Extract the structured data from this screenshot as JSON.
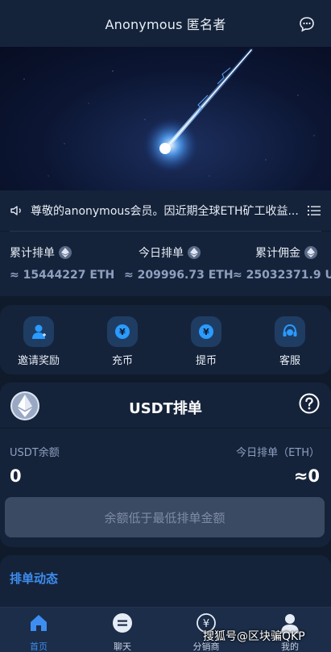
{
  "header": {
    "title": "Anonymous 匿名者",
    "chat_icon": "chat-bubble-icon"
  },
  "banner": {
    "image": "meteor-streak"
  },
  "notice": {
    "text": "尊敬的anonymous会员。因近期全球ETH矿工收益...",
    "speaker_icon": "speaker-icon",
    "list_icon": "list-icon"
  },
  "stats": [
    {
      "label": "累计排单",
      "value": "≈ 15444227 ETH"
    },
    {
      "label": "今日排单",
      "value": "≈ 209996.73 ETH"
    },
    {
      "label": "累计佣金",
      "value": "≈ 25032371.9 U"
    }
  ],
  "quick_actions": [
    {
      "label": "邀请奖励",
      "icon": "user-add-icon"
    },
    {
      "label": "充币",
      "icon": "deposit-icon"
    },
    {
      "label": "提币",
      "icon": "withdraw-icon"
    },
    {
      "label": "客服",
      "icon": "headset-icon"
    }
  ],
  "order_card": {
    "title": "USDT排单",
    "balance_label": "USDT余额",
    "balance_value": "0",
    "today_label": "今日排单（ETH）",
    "today_value": "≈0",
    "action_label": "余额低于最低排单金额"
  },
  "dynamic": {
    "title": "排单动态"
  },
  "tabbar": [
    {
      "label": "首页",
      "icon": "home-icon",
      "active": true
    },
    {
      "label": "聊天",
      "icon": "chat-icon",
      "active": false
    },
    {
      "label": "分销商",
      "icon": "yen-icon",
      "active": false
    },
    {
      "label": "我的",
      "icon": "user-icon",
      "active": false
    }
  ],
  "watermark": "搜狐号@区块骗QKP",
  "colors": {
    "accent": "#3d8ef0",
    "background": "#0f1a2b",
    "panel": "#15233a"
  }
}
